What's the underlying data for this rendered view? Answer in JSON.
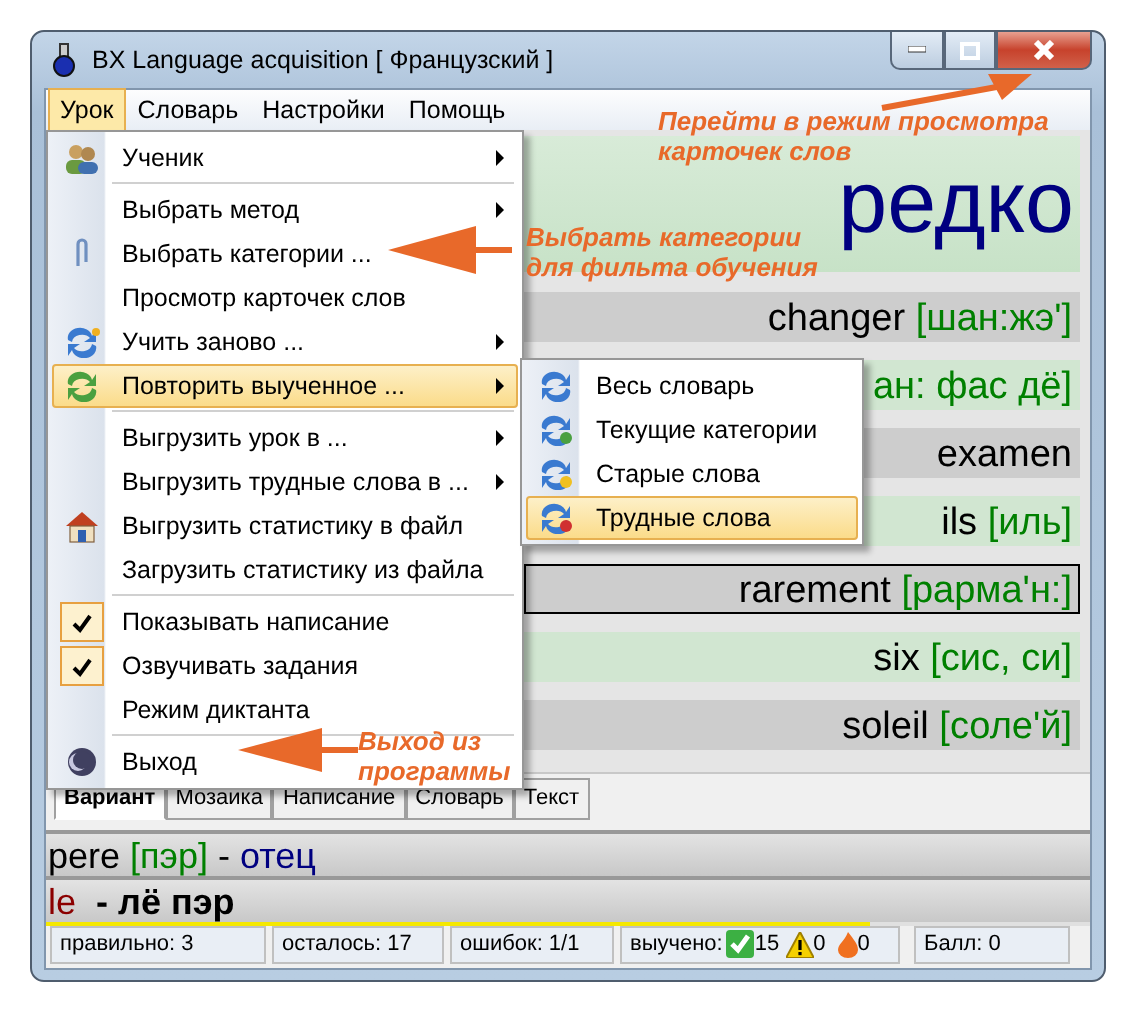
{
  "window": {
    "title": "BX Language acquisition [ Французский ]"
  },
  "menu_bar": [
    {
      "label": "Урок",
      "selected": true
    },
    {
      "label": "Словарь",
      "selected": false
    },
    {
      "label": "Настройки",
      "selected": false
    },
    {
      "label": "Помощь",
      "selected": false
    }
  ],
  "prompt": "редко",
  "answers": [
    {
      "word": "changer",
      "transcription": "[шан:жэ']",
      "selected": false
    },
    {
      "transcription": "ан: фас дё]",
      "selected": false
    },
    {
      "word": "examen",
      "selected": false
    },
    {
      "word": "ils",
      "transcription": "[иль]",
      "selected": false
    },
    {
      "word": "rarement",
      "transcription": "[рарма'н:]",
      "selected": true
    },
    {
      "word": "six",
      "transcription": "[сис, си]",
      "selected": false
    },
    {
      "word": "soleil",
      "transcription": "[соле'й]",
      "selected": false
    }
  ],
  "mode_tabs": [
    {
      "label": "Вариант",
      "selected": true
    },
    {
      "label": "Мозаика",
      "selected": false
    },
    {
      "label": "Написание",
      "selected": false
    },
    {
      "label": "Словарь",
      "selected": false
    },
    {
      "label": "Текст",
      "selected": false
    }
  ],
  "last_answer": {
    "word": "pere",
    "transcription": "[пэр]",
    "dash": "-",
    "translation": "отец"
  },
  "hint": {
    "article": "le",
    "reading": "- лё пэр"
  },
  "progress": {
    "level": 0.79
  },
  "status_bar": {
    "correct": "правильно: 3",
    "remaining": "осталось: 17",
    "errors": "ошибок: 1/1",
    "learned_label": "выучено:",
    "learned": "15",
    "warned": "0",
    "hard": "0",
    "score": "Балл: 0"
  },
  "dropdown_menu": [
    {
      "kind": "item",
      "label": "Ученик",
      "submenu": true,
      "selected": false
    },
    {
      "kind": "separator"
    },
    {
      "kind": "item",
      "label": "Выбрать метод",
      "submenu": true,
      "selected": false
    },
    {
      "kind": "item",
      "label": "Выбрать категории ...",
      "submenu": false,
      "selected": false
    },
    {
      "kind": "item",
      "label": "Просмотр карточек слов",
      "submenu": false,
      "selected": false
    },
    {
      "kind": "item",
      "label": "Учить заново ...",
      "submenu": true,
      "selected": false
    },
    {
      "kind": "item",
      "label": "Повторить выученное ...",
      "submenu": true,
      "selected": true
    },
    {
      "kind": "separator"
    },
    {
      "kind": "item",
      "label": "Выгрузить урок в ...",
      "submenu": true,
      "selected": false
    },
    {
      "kind": "item",
      "label": "Выгрузить трудные слова в ...",
      "submenu": true,
      "selected": false
    },
    {
      "kind": "item",
      "label": "Выгрузить статистику в файл",
      "submenu": false,
      "selected": false
    },
    {
      "kind": "item",
      "label": "Загрузить статистику из файла",
      "submenu": false,
      "selected": false
    },
    {
      "kind": "separator"
    },
    {
      "kind": "check",
      "label": "Показывать написание",
      "checked": true,
      "selected": false
    },
    {
      "kind": "check",
      "label": "Озвучивать задания",
      "checked": true,
      "selected": false
    },
    {
      "kind": "check",
      "label": "Режим диктанта",
      "checked": false,
      "selected": false
    },
    {
      "kind": "separator"
    },
    {
      "kind": "item",
      "label": "Выход",
      "submenu": false,
      "selected": false
    }
  ],
  "submenu": [
    {
      "label": "Весь словарь",
      "selected": false
    },
    {
      "label": "Текущие категории",
      "selected": false
    },
    {
      "label": "Старые слова",
      "selected": false
    },
    {
      "label": "Трудные слова",
      "selected": true
    }
  ],
  "annotations": [
    {
      "lines": [
        "Перейти в режим просмотра",
        "карточек слов"
      ]
    },
    {
      "lines": [
        "Выбрать категории",
        "для фильта обучения"
      ]
    },
    {
      "lines": [
        "Выход из",
        "программы"
      ]
    }
  ]
}
